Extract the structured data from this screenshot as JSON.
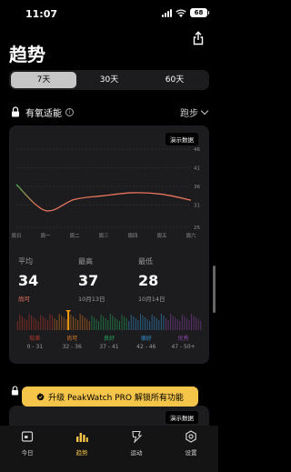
{
  "status_bar": {
    "time": "11:07",
    "battery": "68"
  },
  "page_title": "趋势",
  "segments": [
    {
      "label": "7天",
      "active": true
    },
    {
      "label": "30天",
      "active": false
    },
    {
      "label": "60天",
      "active": false
    }
  ],
  "section": {
    "title": "有氧适能",
    "sport": "跑步"
  },
  "demo_badge": "演示数据",
  "chart_data": {
    "type": "line",
    "x": [
      "周日",
      "周一",
      "周二",
      "周三",
      "周四",
      "周五",
      "周六"
    ],
    "y_ticks": [
      46,
      41,
      36,
      31,
      25
    ],
    "ylim": [
      25,
      46
    ],
    "series": [
      {
        "values": [
          36.5,
          29.5,
          32.5,
          33.5,
          34.3,
          33.9,
          32.3
        ]
      }
    ],
    "line_color_start": "#4caf50",
    "line_color": "#e8745d"
  },
  "stats": [
    {
      "label": "平均",
      "value": "34",
      "sub": "尚可",
      "warn": true
    },
    {
      "label": "最高",
      "value": "37",
      "sub": "10月13日",
      "warn": false
    },
    {
      "label": "最低",
      "value": "28",
      "sub": "10月14日",
      "warn": false
    }
  ],
  "scale": {
    "marker_value": 34,
    "levels": [
      {
        "name": "较差",
        "range": "0 - 31",
        "color": "#c0392b"
      },
      {
        "name": "尚可",
        "range": "32 - 36",
        "color": "#e67e22"
      },
      {
        "name": "良好",
        "range": "37 - 41",
        "color": "#27ae60"
      },
      {
        "name": "很好",
        "range": "42 - 46",
        "color": "#3498db"
      },
      {
        "name": "优秀",
        "range": "47 - 50+",
        "color": "#8e44ad"
      }
    ]
  },
  "upgrade": {
    "label": "升级 PeakWatch PRO 解锁所有功能"
  },
  "tabs": [
    {
      "label": "今日",
      "active": false,
      "icon": "today-icon"
    },
    {
      "label": "趋势",
      "active": true,
      "icon": "trends-icon"
    },
    {
      "label": "运动",
      "active": false,
      "icon": "workout-icon"
    },
    {
      "label": "设置",
      "active": false,
      "icon": "settings-icon"
    }
  ]
}
